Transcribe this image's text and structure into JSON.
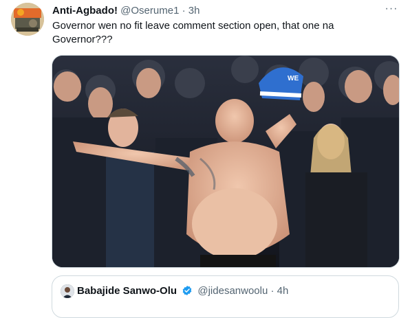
{
  "tweet": {
    "display_name": "Anti-Agbado!",
    "handle": "@Oserume1",
    "separator": "·",
    "time": "3h",
    "more_label": "···",
    "text": "Governor wen no fit leave comment section open, that one na Governor???"
  },
  "media": {
    "alt_icon": "crowd-photo",
    "hat_text": "WE"
  },
  "quoted_tweet": {
    "display_name": "Babajide Sanwo-Olu",
    "handle": "@jidesanwoolu",
    "separator": "·",
    "time": "4h",
    "verified_icon": "verified-badge-icon"
  },
  "colors": {
    "text_primary": "#0f1419",
    "text_secondary": "#536471",
    "border": "#cfd9de",
    "verified_blue": "#1d9bf0"
  }
}
